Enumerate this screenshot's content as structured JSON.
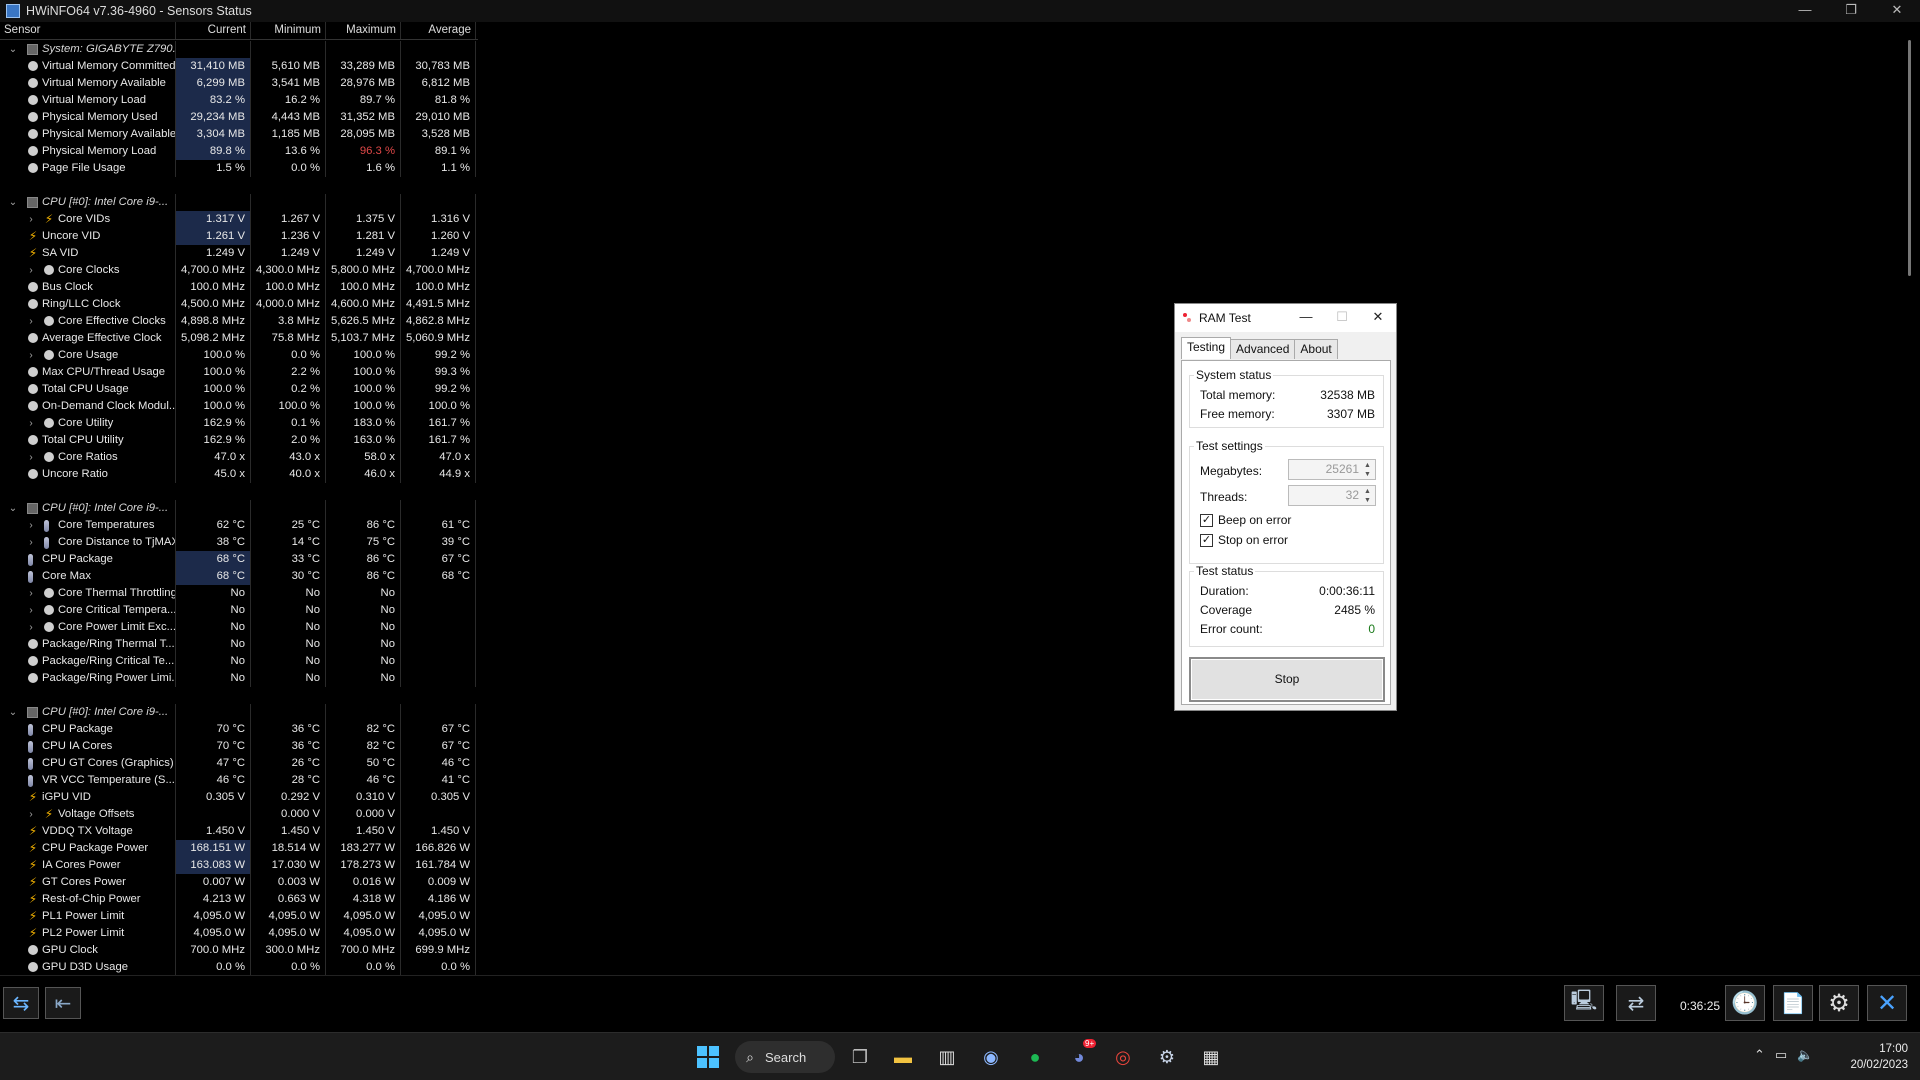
{
  "window": {
    "title": "HWiNFO64 v7.36-4960 - Sensors Status",
    "controls": [
      "—",
      "❐",
      "✕"
    ]
  },
  "columns": [
    "Sensor",
    "Current",
    "Minimum",
    "Maximum",
    "Average"
  ],
  "rows": [
    {
      "kind": "group",
      "name": "System: GIGABYTE Z790..."
    },
    {
      "kind": "row",
      "icon": "circle",
      "name": "Virtual Memory Committed",
      "cur": "31,410 MB",
      "min": "5,610 MB",
      "max": "33,289 MB",
      "avg": "30,783 MB",
      "hl": true
    },
    {
      "kind": "row",
      "icon": "circle",
      "name": "Virtual Memory Available",
      "cur": "6,299 MB",
      "min": "3,541 MB",
      "max": "28,976 MB",
      "avg": "6,812 MB",
      "hl": true
    },
    {
      "kind": "row",
      "icon": "circle",
      "name": "Virtual Memory Load",
      "cur": "83.2 %",
      "min": "16.2 %",
      "max": "89.7 %",
      "avg": "81.8 %",
      "hl": true
    },
    {
      "kind": "row",
      "icon": "circle",
      "name": "Physical Memory Used",
      "cur": "29,234 MB",
      "min": "4,443 MB",
      "max": "31,352 MB",
      "avg": "29,010 MB",
      "hl": true
    },
    {
      "kind": "row",
      "icon": "circle",
      "name": "Physical Memory Available",
      "cur": "3,304 MB",
      "min": "1,185 MB",
      "max": "28,095 MB",
      "avg": "3,528 MB",
      "hl": true
    },
    {
      "kind": "row",
      "icon": "circle",
      "name": "Physical Memory Load",
      "cur": "89.8 %",
      "min": "13.6 %",
      "max": "96.3 %",
      "avg": "89.1 %",
      "hl": true,
      "maxRed": true
    },
    {
      "kind": "row",
      "icon": "circle",
      "name": "Page File Usage",
      "cur": "1.5 %",
      "min": "0.0 %",
      "max": "1.6 %",
      "avg": "1.1 %"
    },
    {
      "kind": "blank"
    },
    {
      "kind": "group",
      "name": "CPU [#0]: Intel Core i9-..."
    },
    {
      "kind": "row",
      "icon": "bolt",
      "exp": true,
      "name": "Core VIDs",
      "cur": "1.317 V",
      "min": "1.267 V",
      "max": "1.375 V",
      "avg": "1.316 V",
      "hl": true
    },
    {
      "kind": "row",
      "icon": "bolt",
      "name": "Uncore VID",
      "cur": "1.261 V",
      "min": "1.236 V",
      "max": "1.281 V",
      "avg": "1.260 V",
      "hl": true
    },
    {
      "kind": "row",
      "icon": "bolt",
      "name": "SA VID",
      "cur": "1.249 V",
      "min": "1.249 V",
      "max": "1.249 V",
      "avg": "1.249 V"
    },
    {
      "kind": "row",
      "icon": "circle",
      "exp": true,
      "name": "Core Clocks",
      "cur": "4,700.0 MHz",
      "min": "4,300.0 MHz",
      "max": "5,800.0 MHz",
      "avg": "4,700.0 MHz"
    },
    {
      "kind": "row",
      "icon": "circle",
      "name": "Bus Clock",
      "cur": "100.0 MHz",
      "min": "100.0 MHz",
      "max": "100.0 MHz",
      "avg": "100.0 MHz"
    },
    {
      "kind": "row",
      "icon": "circle",
      "name": "Ring/LLC Clock",
      "cur": "4,500.0 MHz",
      "min": "4,000.0 MHz",
      "max": "4,600.0 MHz",
      "avg": "4,491.5 MHz"
    },
    {
      "kind": "row",
      "icon": "circle",
      "exp": true,
      "name": "Core Effective Clocks",
      "cur": "4,898.8 MHz",
      "min": "3.8 MHz",
      "max": "5,626.5 MHz",
      "avg": "4,862.8 MHz"
    },
    {
      "kind": "row",
      "icon": "circle",
      "name": "Average Effective Clock",
      "cur": "5,098.2 MHz",
      "min": "75.8 MHz",
      "max": "5,103.7 MHz",
      "avg": "5,060.9 MHz"
    },
    {
      "kind": "row",
      "icon": "circle",
      "exp": true,
      "name": "Core Usage",
      "cur": "100.0 %",
      "min": "0.0 %",
      "max": "100.0 %",
      "avg": "99.2 %"
    },
    {
      "kind": "row",
      "icon": "circle",
      "name": "Max CPU/Thread Usage",
      "cur": "100.0 %",
      "min": "2.2 %",
      "max": "100.0 %",
      "avg": "99.3 %"
    },
    {
      "kind": "row",
      "icon": "circle",
      "name": "Total CPU Usage",
      "cur": "100.0 %",
      "min": "0.2 %",
      "max": "100.0 %",
      "avg": "99.2 %"
    },
    {
      "kind": "row",
      "icon": "circle",
      "name": "On-Demand Clock Modul...",
      "cur": "100.0 %",
      "min": "100.0 %",
      "max": "100.0 %",
      "avg": "100.0 %"
    },
    {
      "kind": "row",
      "icon": "circle",
      "exp": true,
      "name": "Core Utility",
      "cur": "162.9 %",
      "min": "0.1 %",
      "max": "183.0 %",
      "avg": "161.7 %"
    },
    {
      "kind": "row",
      "icon": "circle",
      "name": "Total CPU Utility",
      "cur": "162.9 %",
      "min": "2.0 %",
      "max": "163.0 %",
      "avg": "161.7 %"
    },
    {
      "kind": "row",
      "icon": "circle",
      "exp": true,
      "name": "Core Ratios",
      "cur": "47.0 x",
      "min": "43.0 x",
      "max": "58.0 x",
      "avg": "47.0 x"
    },
    {
      "kind": "row",
      "icon": "circle",
      "name": "Uncore Ratio",
      "cur": "45.0 x",
      "min": "40.0 x",
      "max": "46.0 x",
      "avg": "44.9 x"
    },
    {
      "kind": "blank"
    },
    {
      "kind": "group",
      "name": "CPU [#0]: Intel Core i9-..."
    },
    {
      "kind": "row",
      "icon": "therm",
      "exp": true,
      "name": "Core Temperatures",
      "cur": "62 °C",
      "min": "25 °C",
      "max": "86 °C",
      "avg": "61 °C"
    },
    {
      "kind": "row",
      "icon": "therm",
      "exp": true,
      "name": "Core Distance to TjMAX",
      "cur": "38 °C",
      "min": "14 °C",
      "max": "75 °C",
      "avg": "39 °C"
    },
    {
      "kind": "row",
      "icon": "therm",
      "name": "CPU Package",
      "cur": "68 °C",
      "min": "33 °C",
      "max": "86 °C",
      "avg": "67 °C",
      "hl": true
    },
    {
      "kind": "row",
      "icon": "therm",
      "name": "Core Max",
      "cur": "68 °C",
      "min": "30 °C",
      "max": "86 °C",
      "avg": "68 °C",
      "hl": true
    },
    {
      "kind": "row",
      "icon": "circle",
      "exp": true,
      "name": "Core Thermal Throttling",
      "cur": "No",
      "min": "No",
      "max": "No",
      "avg": ""
    },
    {
      "kind": "row",
      "icon": "circle",
      "exp": true,
      "name": "Core Critical Tempera...",
      "cur": "No",
      "min": "No",
      "max": "No",
      "avg": ""
    },
    {
      "kind": "row",
      "icon": "circle",
      "exp": true,
      "name": "Core Power Limit Exc...",
      "cur": "No",
      "min": "No",
      "max": "No",
      "avg": ""
    },
    {
      "kind": "row",
      "icon": "circle",
      "name": "Package/Ring Thermal T...",
      "cur": "No",
      "min": "No",
      "max": "No",
      "avg": ""
    },
    {
      "kind": "row",
      "icon": "circle",
      "name": "Package/Ring Critical Te...",
      "cur": "No",
      "min": "No",
      "max": "No",
      "avg": ""
    },
    {
      "kind": "row",
      "icon": "circle",
      "name": "Package/Ring Power Limi...",
      "cur": "No",
      "min": "No",
      "max": "No",
      "avg": ""
    },
    {
      "kind": "blank"
    },
    {
      "kind": "group",
      "name": "CPU [#0]: Intel Core i9-..."
    },
    {
      "kind": "row",
      "icon": "therm",
      "name": "CPU Package",
      "cur": "70 °C",
      "min": "36 °C",
      "max": "82 °C",
      "avg": "67 °C"
    },
    {
      "kind": "row",
      "icon": "therm",
      "name": "CPU IA Cores",
      "cur": "70 °C",
      "min": "36 °C",
      "max": "82 °C",
      "avg": "67 °C"
    },
    {
      "kind": "row",
      "icon": "therm",
      "name": "CPU GT Cores (Graphics)",
      "cur": "47 °C",
      "min": "26 °C",
      "max": "50 °C",
      "avg": "46 °C"
    },
    {
      "kind": "row",
      "icon": "therm",
      "name": "VR VCC Temperature (S...",
      "cur": "46 °C",
      "min": "28 °C",
      "max": "46 °C",
      "avg": "41 °C"
    },
    {
      "kind": "row",
      "icon": "bolt",
      "name": "iGPU VID",
      "cur": "0.305 V",
      "min": "0.292 V",
      "max": "0.310 V",
      "avg": "0.305 V"
    },
    {
      "kind": "row",
      "icon": "bolt",
      "exp": true,
      "name": "Voltage Offsets",
      "cur": "",
      "min": "0.000 V",
      "max": "0.000 V",
      "avg": ""
    },
    {
      "kind": "row",
      "icon": "bolt",
      "name": "VDDQ TX Voltage",
      "cur": "1.450 V",
      "min": "1.450 V",
      "max": "1.450 V",
      "avg": "1.450 V"
    },
    {
      "kind": "row",
      "icon": "bolt",
      "name": "CPU Package Power",
      "cur": "168.151 W",
      "min": "18.514 W",
      "max": "183.277 W",
      "avg": "166.826 W",
      "hl": true
    },
    {
      "kind": "row",
      "icon": "bolt",
      "name": "IA Cores Power",
      "cur": "163.083 W",
      "min": "17.030 W",
      "max": "178.273 W",
      "avg": "161.784 W",
      "hl": true
    },
    {
      "kind": "row",
      "icon": "bolt",
      "name": "GT Cores Power",
      "cur": "0.007 W",
      "min": "0.003 W",
      "max": "0.016 W",
      "avg": "0.009 W"
    },
    {
      "kind": "row",
      "icon": "bolt",
      "name": "Rest-of-Chip Power",
      "cur": "4.213 W",
      "min": "0.663 W",
      "max": "4.318 W",
      "avg": "4.186 W"
    },
    {
      "kind": "row",
      "icon": "bolt",
      "name": "PL1 Power Limit",
      "cur": "4,095.0 W",
      "min": "4,095.0 W",
      "max": "4,095.0 W",
      "avg": "4,095.0 W"
    },
    {
      "kind": "row",
      "icon": "bolt",
      "name": "PL2 Power Limit",
      "cur": "4,095.0 W",
      "min": "4,095.0 W",
      "max": "4,095.0 W",
      "avg": "4,095.0 W"
    },
    {
      "kind": "row",
      "icon": "circle",
      "name": "GPU Clock",
      "cur": "700.0 MHz",
      "min": "300.0 MHz",
      "max": "700.0 MHz",
      "avg": "699.9 MHz"
    },
    {
      "kind": "row",
      "icon": "circle",
      "name": "GPU D3D Usage",
      "cur": "0.0 %",
      "min": "0.0 %",
      "max": "0.0 %",
      "avg": "0.0 %"
    }
  ],
  "toolbar": {
    "timer": "0:36:25"
  },
  "ramtest": {
    "title": "RAM Test",
    "tabs": [
      "Testing",
      "Advanced",
      "About"
    ],
    "system_status": {
      "heading": "System status",
      "total_label": "Total memory:",
      "total_value": "32538 MB",
      "free_label": "Free memory:",
      "free_value": "3307 MB"
    },
    "test_settings": {
      "heading": "Test settings",
      "megabytes_label": "Megabytes:",
      "megabytes_value": "25261",
      "threads_label": "Threads:",
      "threads_value": "32",
      "beep_label": "Beep on error",
      "stop_label": "Stop on error"
    },
    "test_status": {
      "heading": "Test status",
      "duration_label": "Duration:",
      "duration_value": "0:00:36:11",
      "coverage_label": "Coverage",
      "coverage_value": "2485 %",
      "errors_label": "Error count:",
      "errors_value": "0"
    },
    "stop_button": "Stop"
  },
  "taskbar": {
    "search_label": "Search",
    "time": "17:00",
    "date": "20/02/2023",
    "discord_badge": "9+"
  },
  "colors": {
    "highlight": "#1c2a4a",
    "alert": "#e04848",
    "accent": "#6cb6ff"
  }
}
